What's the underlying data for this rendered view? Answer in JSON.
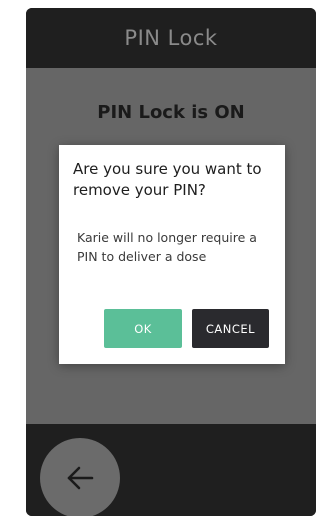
{
  "header": {
    "title": "PIN Lock"
  },
  "status": {
    "title": "PIN Lock is ON"
  },
  "dialog": {
    "question": "Are you sure you want to remove your PIN?",
    "message": "Karie will no longer require a PIN to deliver a dose",
    "ok_label": "OK",
    "cancel_label": "CANCEL"
  },
  "footer": {
    "back_icon": "arrow-left-icon"
  },
  "colors": {
    "ok_button": "#5bbf98",
    "cancel_button": "#2a2a2e",
    "screen_overlay": "#666666",
    "header_bg": "#1f1f1f"
  }
}
